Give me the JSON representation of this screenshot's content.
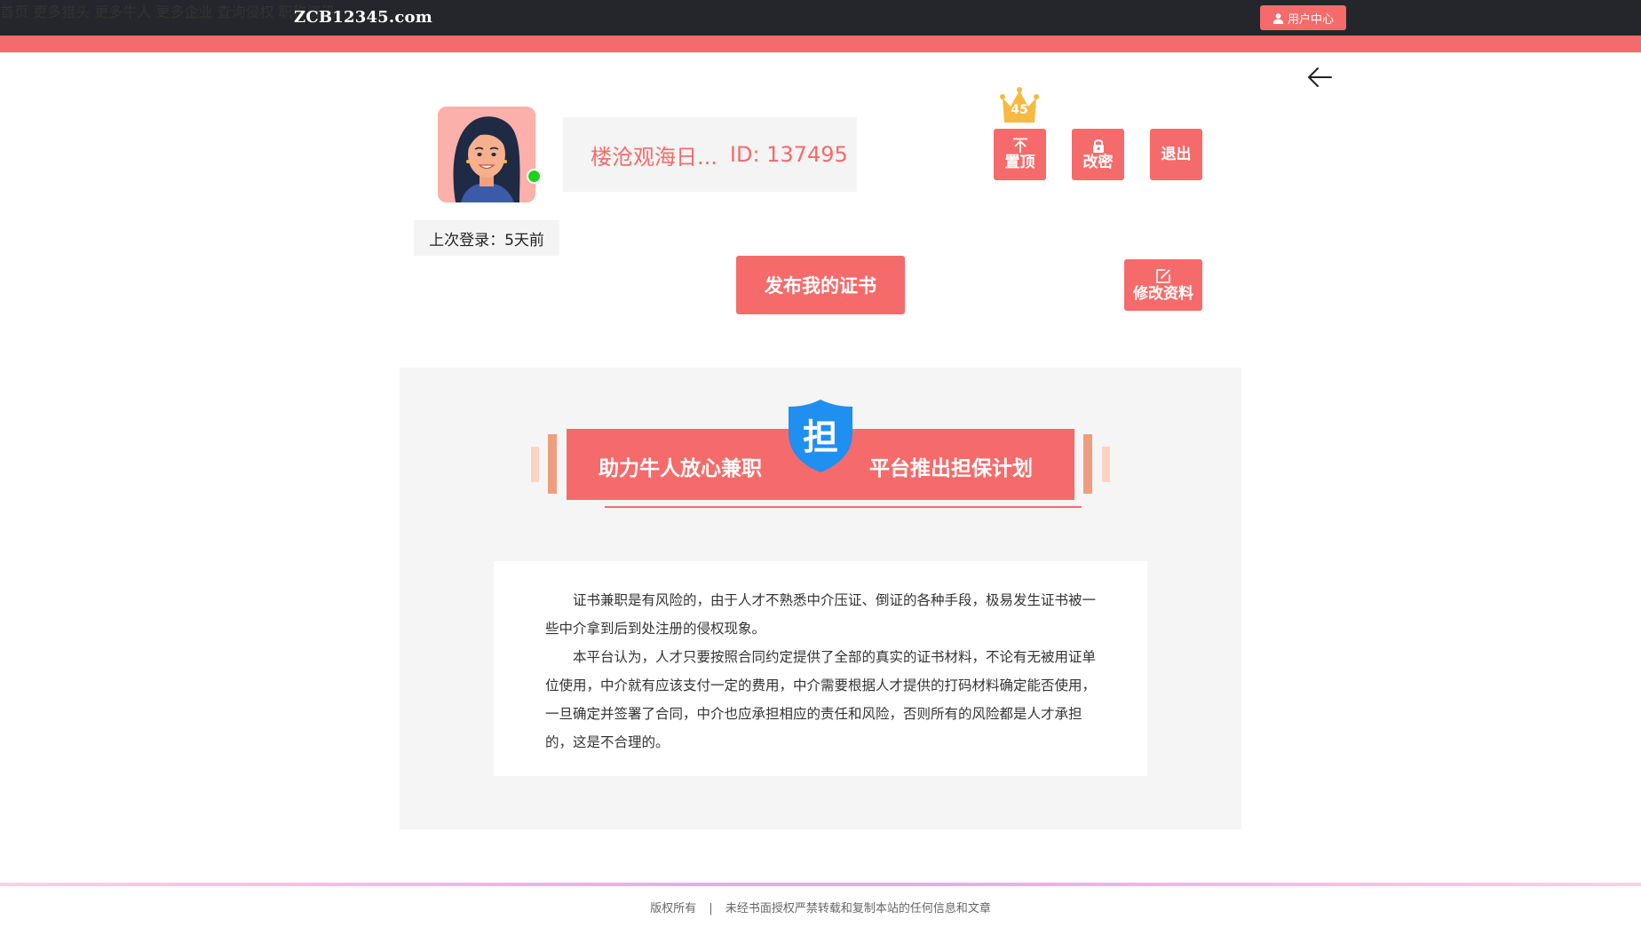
{
  "site": {
    "logo": "ZCB12345.com"
  },
  "nav": {
    "items": [
      "首页",
      "更多猎头",
      "更多牛人",
      "更多企业",
      "查询侵权",
      "职称资讯"
    ],
    "user_center": "用户中心"
  },
  "profile": {
    "name": "楼沧观海日...",
    "id_label": "ID: 137495",
    "last_login_label": "上次登录：",
    "last_login_value": "5天前",
    "crown_count": "45"
  },
  "actions": {
    "top": "置顶",
    "password": "改密",
    "logout": "退出",
    "publish": "发布我的证书",
    "edit_profile": "修改资料"
  },
  "guarantee": {
    "banner_left": "助力牛人放心兼职",
    "banner_right": "平台推出担保计划",
    "shield_char": "担",
    "paragraphs": [
      "证书兼职是有风险的，由于人才不熟悉中介压证、倒证的各种手段，极易发生证书被一些中介拿到后到处注册的侵权现象。",
      "本平台认为，人才只要按照合同约定提供了全部的真实的证书材料，不论有无被用证单位使用，中介就有应该支付一定的费用，中介需要根据人才提供的打码材料确定能否使用，一旦确定并签署了合同，中介也应承担相应的责任和风险，否则所有的风险都是人才承担的，这是不合理的。"
    ]
  },
  "footer": {
    "copyright": "版权所有",
    "separator": "|",
    "notice": "未经书面授权严禁转载和复制本站的任何信息和文章"
  },
  "colors": {
    "accent": "#f56b6b",
    "topbar": "#24262b",
    "online": "#1fd11f",
    "shield": "#1f8ff0",
    "crown": "#f7b941"
  },
  "icons": [
    "user-icon",
    "back-arrow-icon",
    "arrow-up-icon",
    "lock-icon",
    "edit-icon",
    "crown-icon",
    "shield-icon"
  ]
}
